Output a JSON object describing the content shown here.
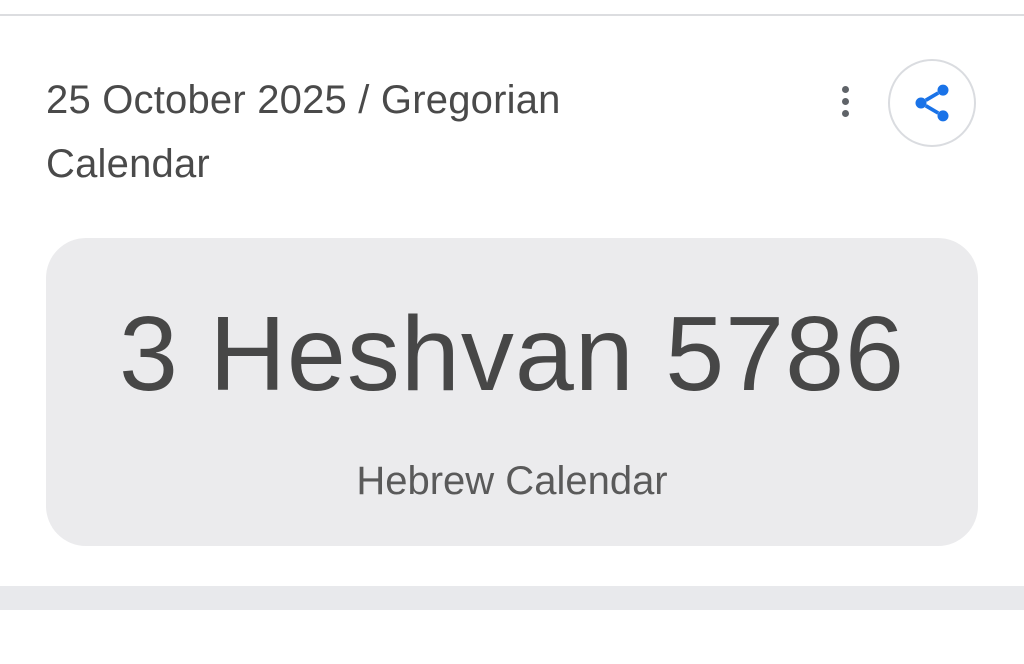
{
  "header": {
    "title": "25 October 2025 / Gregorian Calendar"
  },
  "actions": {
    "more_icon": "more-vert-icon",
    "share_icon": "share-icon",
    "share_color": "#1a73e8"
  },
  "result": {
    "value": "3 Heshvan 5786",
    "label": "Hebrew Calendar"
  },
  "colors": {
    "result_box_bg": "#ebebed",
    "title_text": "#4a4a4a",
    "divider": "#e8e9ec"
  }
}
